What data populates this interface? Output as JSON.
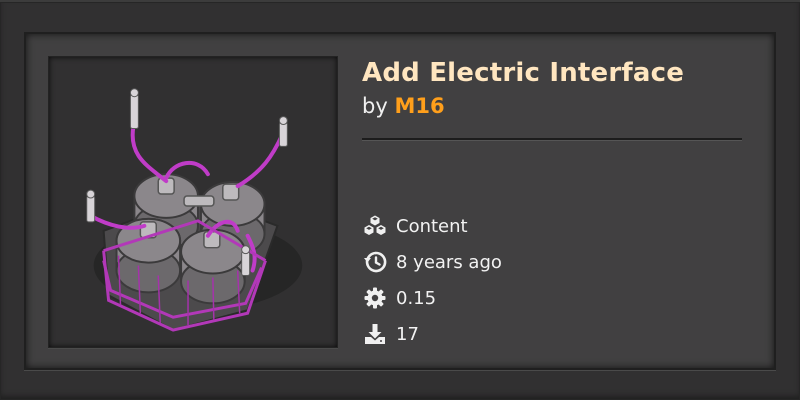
{
  "mod": {
    "title": "Add Electric Interface",
    "by_prefix": "by",
    "author": "M16"
  },
  "meta": {
    "category": {
      "icon": "cubes-icon",
      "label": "Content"
    },
    "updated": {
      "icon": "history-icon",
      "label": "8 years ago"
    },
    "version": {
      "icon": "gear-icon",
      "label": "0.15"
    },
    "downloads": {
      "icon": "download-icon",
      "label": "17"
    }
  },
  "colors": {
    "title": "#ffe6c0",
    "author": "#ff9f1b",
    "card_bg": "#414041",
    "thumb_accent": "#c03cc8"
  },
  "thumbnail": {
    "icon": "electric-interface-structure-image"
  }
}
